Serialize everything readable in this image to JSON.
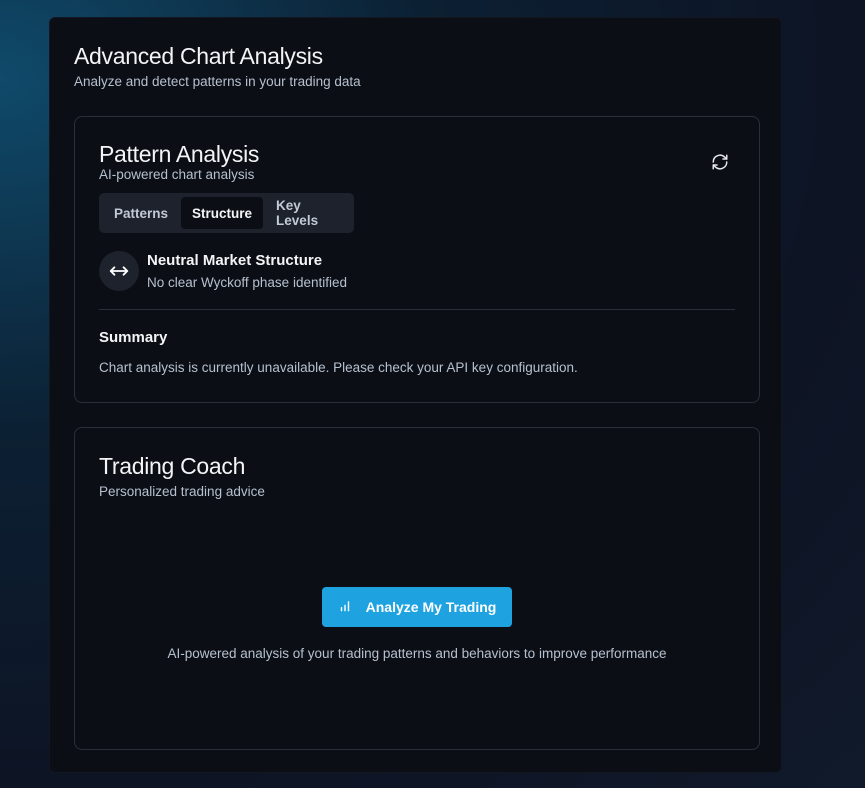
{
  "header": {
    "title": "Advanced Chart Analysis",
    "subtitle": "Analyze and detect patterns in your trading data"
  },
  "pattern_card": {
    "title": "Pattern Analysis",
    "subtitle": "AI-powered chart analysis",
    "refresh_icon": "refresh-icon",
    "tabs": [
      {
        "label": "Patterns",
        "active": false
      },
      {
        "label": "Structure",
        "active": true
      },
      {
        "label": "Key Levels",
        "active": false
      }
    ],
    "structure": {
      "icon": "arrows-left-right-icon",
      "title": "Neutral Market Structure",
      "description": "No clear Wyckoff phase identified"
    },
    "summary": {
      "title": "Summary",
      "text": "Chart analysis is currently unavailable. Please check your API key configuration."
    }
  },
  "coach_card": {
    "title": "Trading Coach",
    "subtitle": "Personalized trading advice",
    "button_label": "Analyze My Trading",
    "button_icon": "bar-chart-icon",
    "description": "AI-powered analysis of your trading patterns and behaviors to improve performance"
  },
  "colors": {
    "accent": "#1fa3e0",
    "panel": "#0b0e15",
    "border": "#2a2f3a"
  }
}
